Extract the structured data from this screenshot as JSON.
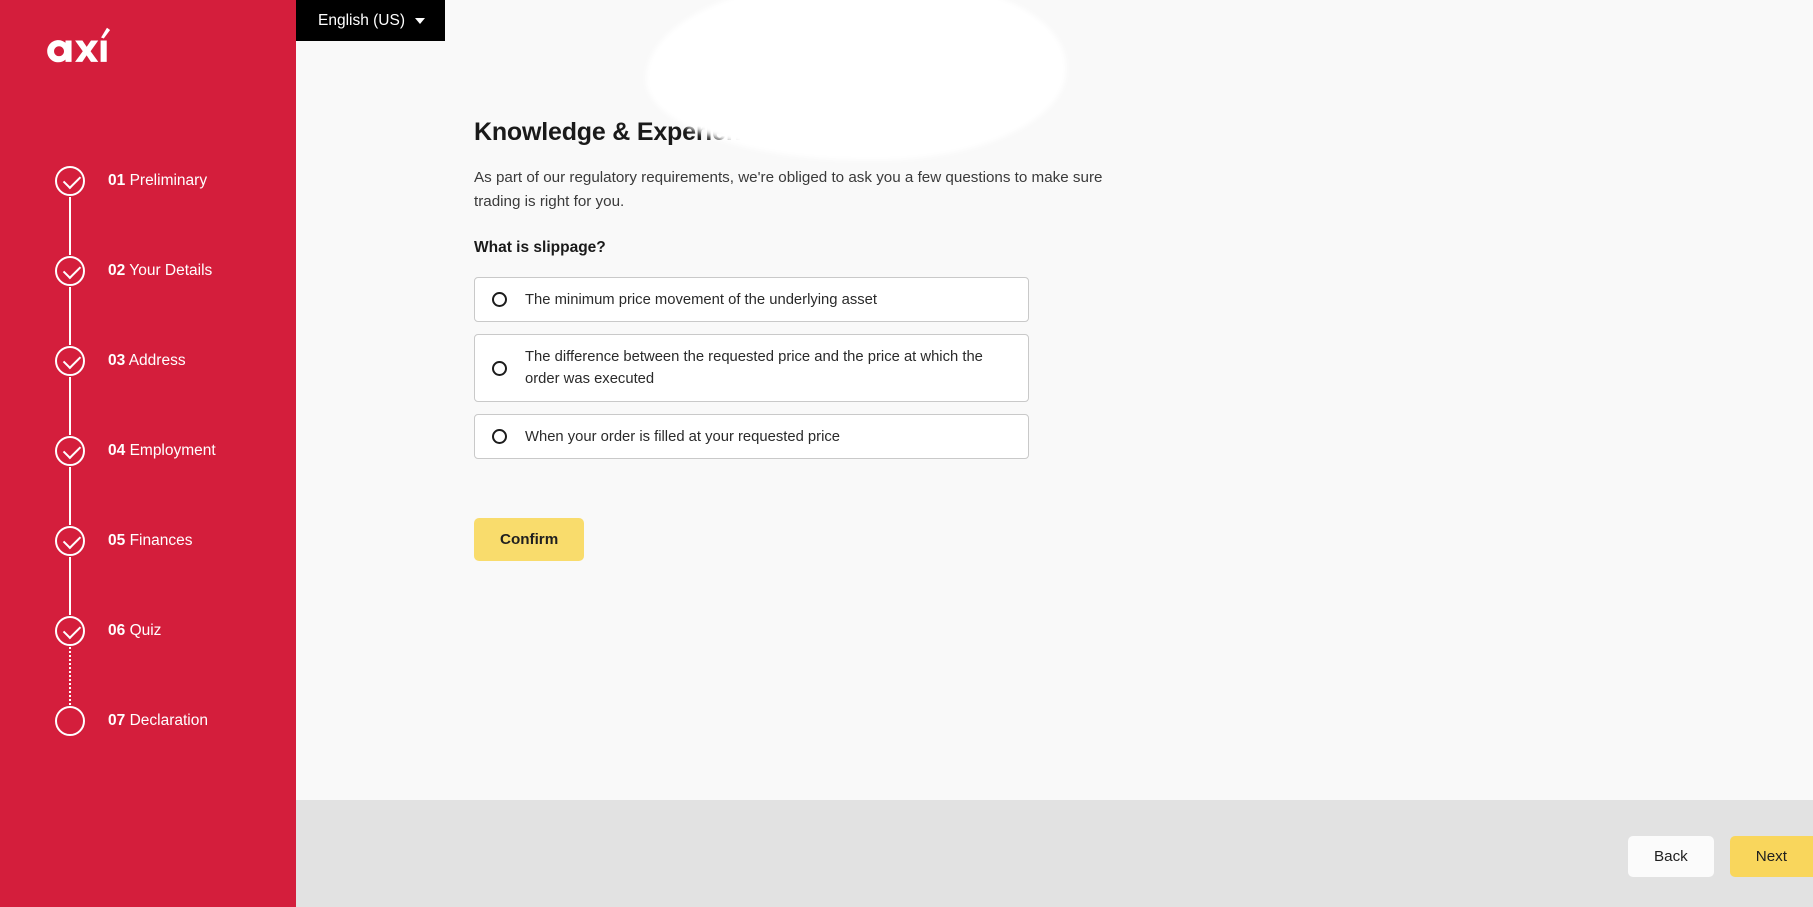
{
  "brand": {
    "logo_text": "axi",
    "primary_color": "#d41e3c",
    "accent_color": "#f9dc6c"
  },
  "header": {
    "language_label": "English (US)",
    "caret_icon": "chevron-down-icon"
  },
  "sidebar": {
    "steps": [
      {
        "number": "01",
        "label": "Preliminary",
        "state": "done"
      },
      {
        "number": "02",
        "label": "Your Details",
        "state": "done"
      },
      {
        "number": "03",
        "label": "Address",
        "state": "done"
      },
      {
        "number": "04",
        "label": "Employment",
        "state": "done"
      },
      {
        "number": "05",
        "label": "Finances",
        "state": "done"
      },
      {
        "number": "06",
        "label": "Quiz",
        "state": "done"
      },
      {
        "number": "07",
        "label": "Declaration",
        "state": "pending"
      }
    ]
  },
  "main": {
    "title": "Knowledge & Experience",
    "intro": "As part of our regulatory requirements, we're obliged to ask you a few questions to make sure trading is right for you.",
    "question": "What is slippage?",
    "options": [
      {
        "text": "The minimum price movement of the underlying asset",
        "selected": false
      },
      {
        "text": "The difference between the requested price and the price at which the order was executed",
        "selected": false
      },
      {
        "text": "When your order is filled at your requested price",
        "selected": false
      }
    ],
    "confirm_label": "Confirm"
  },
  "footer": {
    "back_label": "Back",
    "next_label": "Next"
  }
}
